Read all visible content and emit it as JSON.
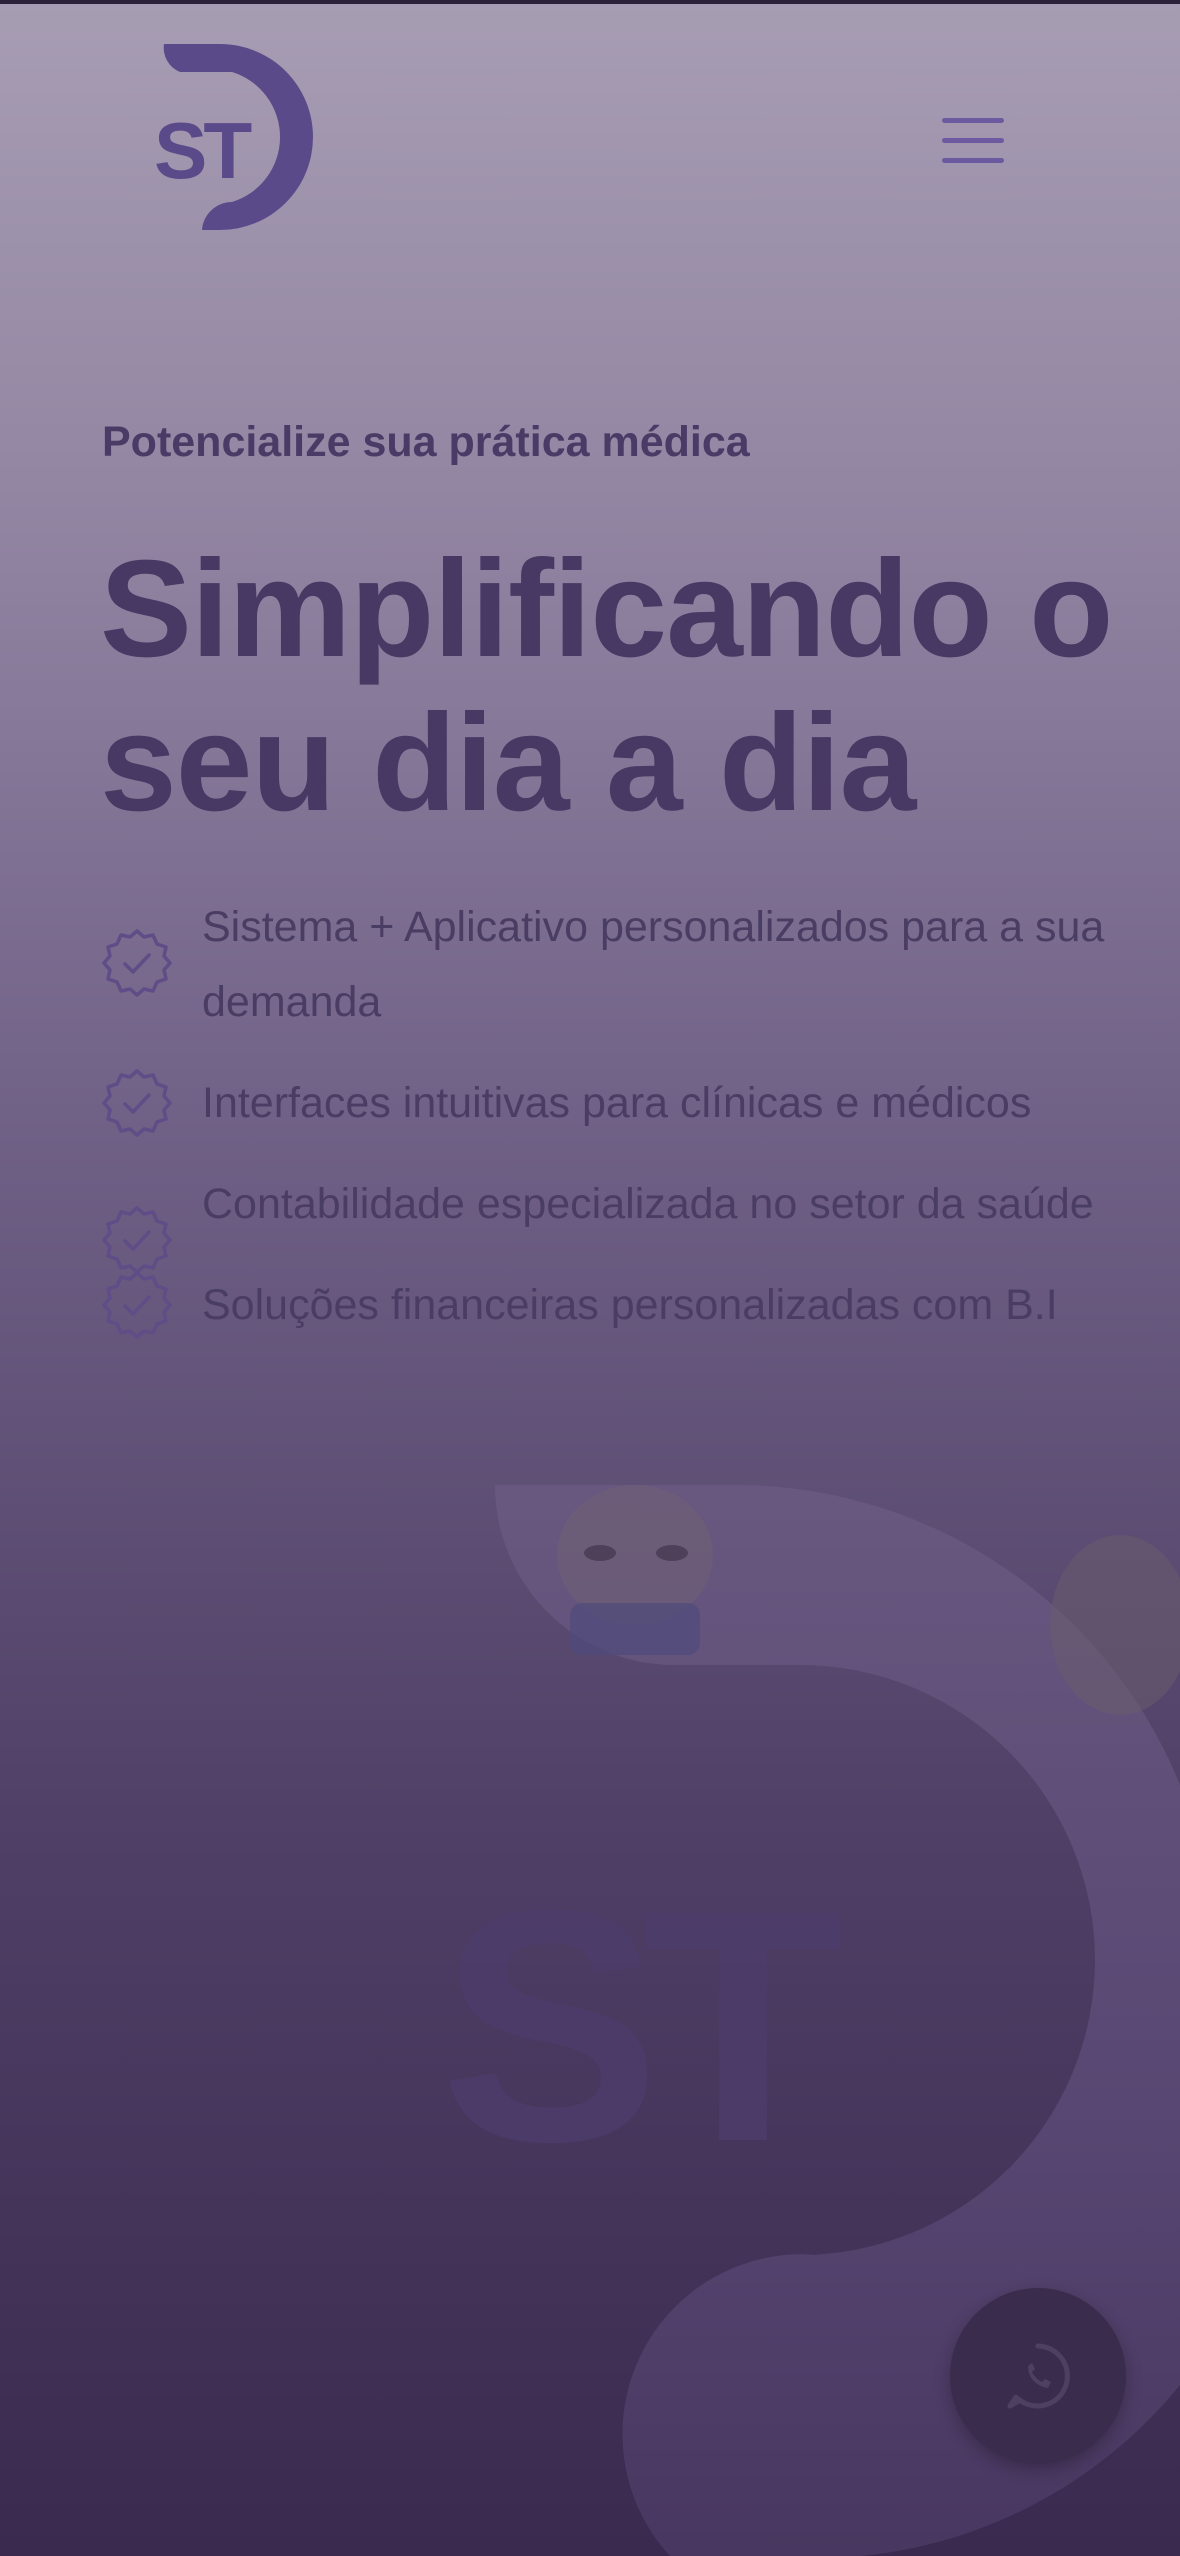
{
  "header": {
    "logo_text": "ST",
    "menu_icon": "hamburger-menu-icon"
  },
  "hero": {
    "eyebrow": "Potencialize sua prática médica",
    "headline_line1": "Simplificando o",
    "headline_line2": "seu dia a dia",
    "features": [
      "Sistema + Aplicativo personalizados para a sua demanda",
      "Interfaces intuitivas para clínicas e médicos",
      "Contabilidade especializada no setor da saúde",
      "Soluções financeiras personalizadas com B.I"
    ],
    "feature_icon": "verified-check-badge-icon"
  },
  "art": {
    "watermark_text": "ST"
  },
  "floating": {
    "whatsapp_icon": "whatsapp-icon"
  },
  "colors": {
    "brand_purple": "#5b4a8a",
    "text_dark_purple": "#473864",
    "bg_top": "#a79db3",
    "bg_bottom": "#3a2a4f"
  }
}
